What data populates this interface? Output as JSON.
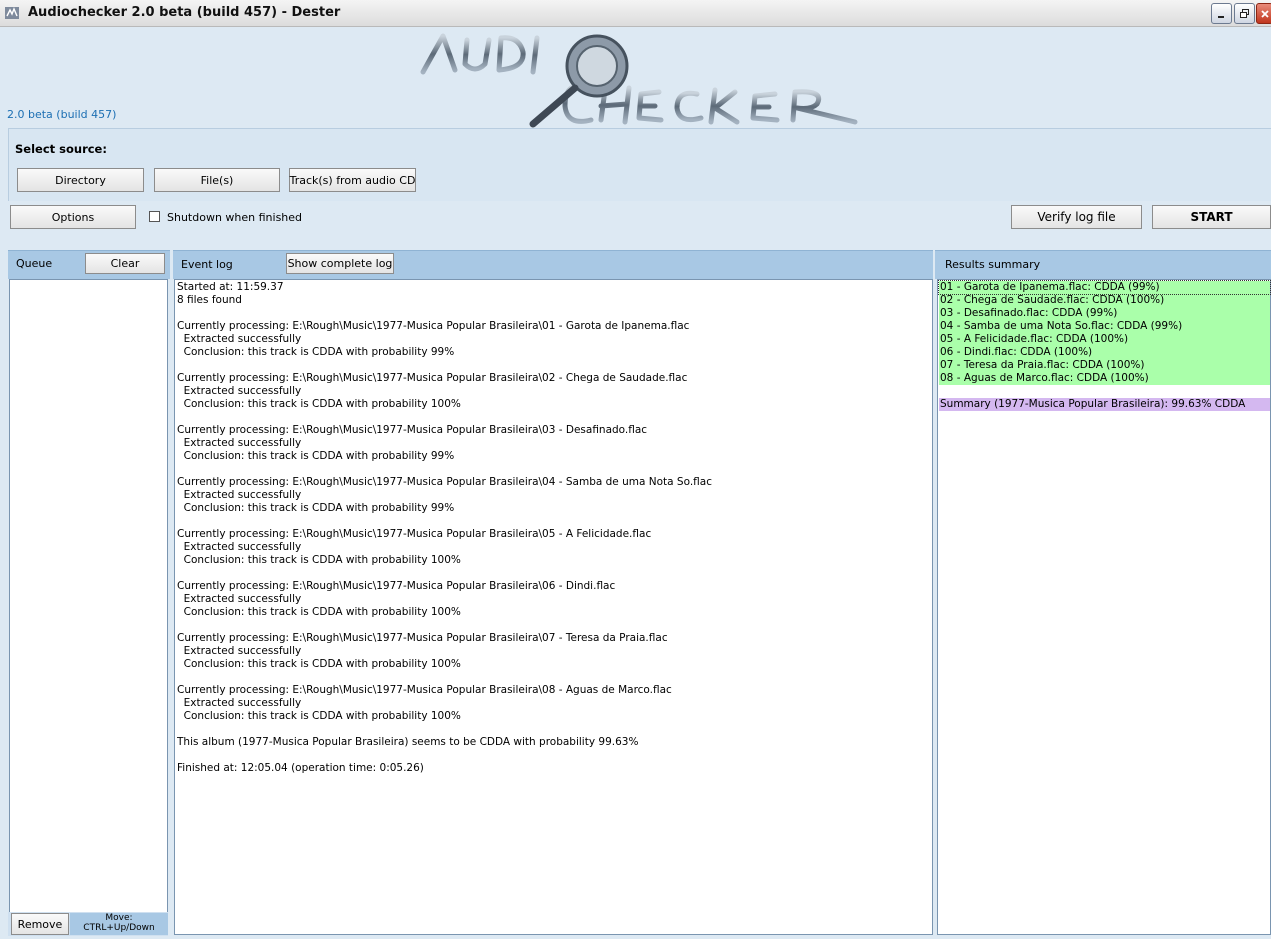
{
  "window": {
    "title": "Audiochecker 2.0 beta (build 457) - Dester",
    "version_label": "2.0 beta (build 457)",
    "logo_text": "AUDIO CHECKER"
  },
  "source": {
    "label": "Select source:",
    "directory_button": "Directory",
    "files_button": "File(s)",
    "cd_button": "Track(s) from audio CD"
  },
  "options": {
    "options_button": "Options",
    "shutdown_label": "Shutdown when finished",
    "shutdown_checked": false,
    "verify_button": "Verify log file",
    "start_button": "START"
  },
  "queue": {
    "title": "Queue",
    "clear_button": "Clear",
    "remove_button": "Remove",
    "move_hint_line1": "Move:",
    "move_hint_line2": "CTRL+Up/Down"
  },
  "event_log": {
    "title": "Event log",
    "show_complete_button": "Show complete log",
    "lines": [
      "Started at: 11:59.37",
      "8 files found",
      "",
      "Currently processing: E:\\Rough\\Music\\1977-Musica Popular Brasileira\\01 - Garota de Ipanema.flac",
      "  Extracted successfully",
      "  Conclusion: this track is CDDA with probability 99%",
      "",
      "Currently processing: E:\\Rough\\Music\\1977-Musica Popular Brasileira\\02 - Chega de Saudade.flac",
      "  Extracted successfully",
      "  Conclusion: this track is CDDA with probability 100%",
      "",
      "Currently processing: E:\\Rough\\Music\\1977-Musica Popular Brasileira\\03 - Desafinado.flac",
      "  Extracted successfully",
      "  Conclusion: this track is CDDA with probability 99%",
      "",
      "Currently processing: E:\\Rough\\Music\\1977-Musica Popular Brasileira\\04 - Samba de uma Nota So.flac",
      "  Extracted successfully",
      "  Conclusion: this track is CDDA with probability 99%",
      "",
      "Currently processing: E:\\Rough\\Music\\1977-Musica Popular Brasileira\\05 - A Felicidade.flac",
      "  Extracted successfully",
      "  Conclusion: this track is CDDA with probability 100%",
      "",
      "Currently processing: E:\\Rough\\Music\\1977-Musica Popular Brasileira\\06 - Dindi.flac",
      "  Extracted successfully",
      "  Conclusion: this track is CDDA with probability 100%",
      "",
      "Currently processing: E:\\Rough\\Music\\1977-Musica Popular Brasileira\\07 - Teresa da Praia.flac",
      "  Extracted successfully",
      "  Conclusion: this track is CDDA with probability 100%",
      "",
      "Currently processing: E:\\Rough\\Music\\1977-Musica Popular Brasileira\\08 - Aguas de Marco.flac",
      "  Extracted successfully",
      "  Conclusion: this track is CDDA with probability 100%",
      "",
      "This album (1977-Musica Popular Brasileira) seems to be CDDA with probability 99.63%",
      "",
      "Finished at: 12:05.04 (operation time: 0:05.26)"
    ]
  },
  "results": {
    "title": "Results summary",
    "items": [
      "01 - Garota de Ipanema.flac: CDDA (99%)",
      "02 - Chega de Saudade.flac: CDDA (100%)",
      "03 - Desafinado.flac: CDDA (99%)",
      "04 - Samba de uma Nota So.flac: CDDA (99%)",
      "05 - A Felicidade.flac: CDDA (100%)",
      "06 - Dindi.flac: CDDA (100%)",
      "07 - Teresa da Praia.flac: CDDA (100%)",
      "08 - Aguas de Marco.flac: CDDA (100%)"
    ],
    "summary": "Summary (1977-Musica Popular Brasileira): 99.63% CDDA",
    "item_color": "#aaffaa",
    "summary_color": "#d4b8f0"
  }
}
